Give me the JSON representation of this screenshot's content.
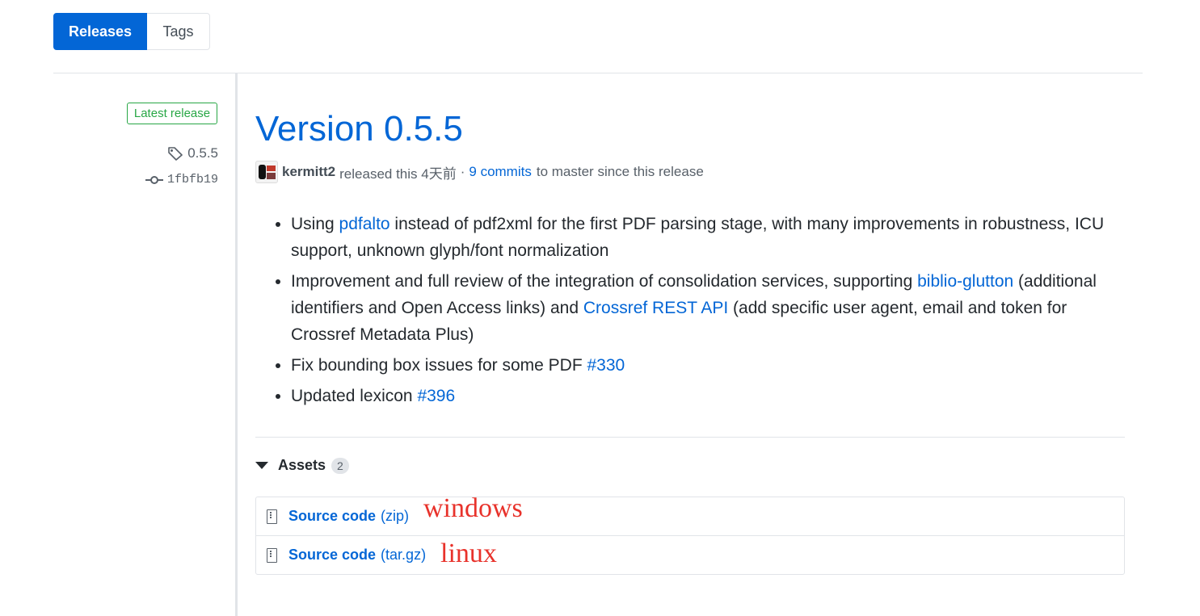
{
  "tabs": {
    "releases": "Releases",
    "tags": "Tags"
  },
  "release": {
    "latest_badge": "Latest release",
    "tag": "0.5.5",
    "commit": "1fbfb19",
    "title": "Version 0.5.5",
    "author": "kermitt2",
    "released_text": "released this 4天前",
    "separator": "·",
    "commits_link": "9 commits",
    "since_text": "to master since this release"
  },
  "notes": [
    {
      "pre": "Using ",
      "link": "pdfalto",
      "post": " instead of pdf2xml for the first PDF parsing stage, with many improvements in robustness, ICU support, unknown glyph/font normalization"
    },
    {
      "pre": "Improvement and full review of the integration of consolidation services, supporting ",
      "link": "biblio-glutton",
      "mid": " (additional identifiers and Open Access links) and ",
      "link2": "Crossref REST API",
      "post": " (add specific user agent, email and token for Crossref Metadata Plus)"
    },
    {
      "pre": "Fix bounding box issues for some PDF ",
      "link": "#330"
    },
    {
      "pre": "Updated lexicon ",
      "link": "#396"
    }
  ],
  "assets": {
    "label": "Assets",
    "count": "2",
    "items": [
      {
        "name": "Source code",
        "ext": "(zip)",
        "annotation": "windows"
      },
      {
        "name": "Source code",
        "ext": "(tar.gz)",
        "annotation": "linux"
      }
    ]
  },
  "icons": {
    "tag": "tag-icon",
    "commit": "git-commit-icon",
    "caret": "triangle-down-icon",
    "archive": "file-zip-icon"
  }
}
